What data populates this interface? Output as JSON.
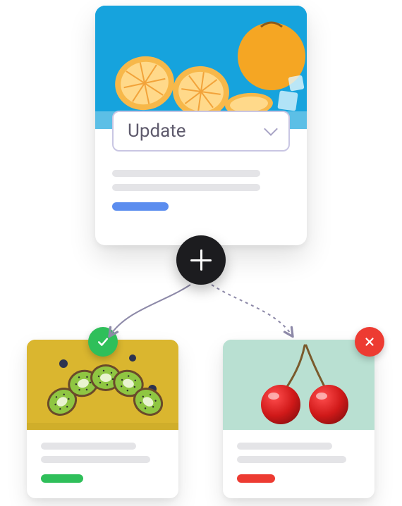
{
  "top_card": {
    "select_label": "Update",
    "select_icon": "chevron-down-icon",
    "accent_color": "#5b8def",
    "image_subject": "sliced oranges on blue background with ice"
  },
  "plus_node": {
    "icon": "plus-icon"
  },
  "arrows": {
    "left": {
      "style": "solid",
      "target": "approved-card"
    },
    "right": {
      "style": "dashed",
      "target": "rejected-card"
    }
  },
  "left_card": {
    "status": "approved",
    "badge_icon": "check-icon",
    "badge_color": "#2fbf5a",
    "accent_color": "#2fbf5a",
    "image_subject": "sliced kiwi and blueberries on yellow background"
  },
  "right_card": {
    "status": "rejected",
    "badge_icon": "x-icon",
    "badge_color": "#ed3b32",
    "accent_color": "#ed3b32",
    "image_subject": "two red cherries on mint background"
  }
}
